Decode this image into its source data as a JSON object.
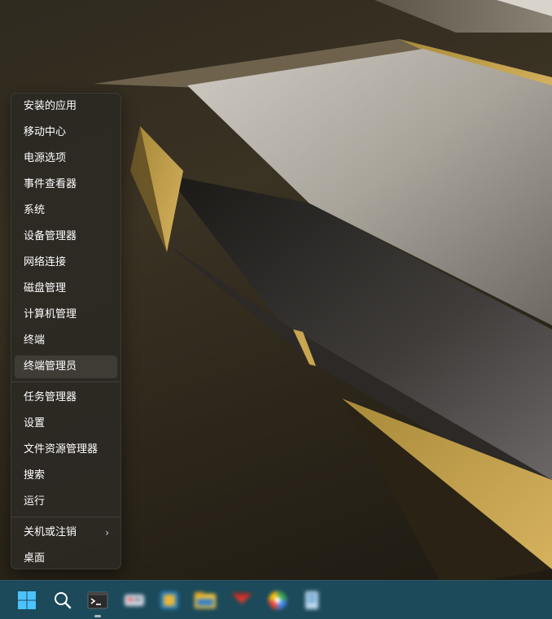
{
  "context_menu": {
    "items": [
      {
        "label": "安装的应用"
      },
      {
        "label": "移动中心"
      },
      {
        "label": "电源选项"
      },
      {
        "label": "事件查看器"
      },
      {
        "label": "系统"
      },
      {
        "label": "设备管理器"
      },
      {
        "label": "网络连接"
      },
      {
        "label": "磁盘管理"
      },
      {
        "label": "计算机管理"
      },
      {
        "label": "终端"
      },
      {
        "label": "终端管理员",
        "highlighted": true
      },
      {
        "label": "任务管理器"
      },
      {
        "label": "设置"
      },
      {
        "label": "文件资源管理器"
      },
      {
        "label": "搜索"
      },
      {
        "label": "运行"
      },
      {
        "label": "关机或注销",
        "submenu": true
      },
      {
        "label": "桌面"
      }
    ],
    "submenu_arrow": "›"
  },
  "taskbar": {
    "icons": [
      {
        "name": "windows-start-icon"
      },
      {
        "name": "search-icon"
      },
      {
        "name": "terminal-icon",
        "running": true
      },
      {
        "name": "blurred-app-icon-1"
      },
      {
        "name": "blurred-app-icon-2"
      },
      {
        "name": "file-explorer-icon"
      },
      {
        "name": "blurred-app-icon-3"
      },
      {
        "name": "blurred-app-icon-4"
      },
      {
        "name": "blurred-app-icon-5"
      }
    ]
  },
  "colors": {
    "taskbar": "#1c4a5a",
    "menu_background": "#2c2924",
    "accent_gold": "#c8a24a"
  }
}
